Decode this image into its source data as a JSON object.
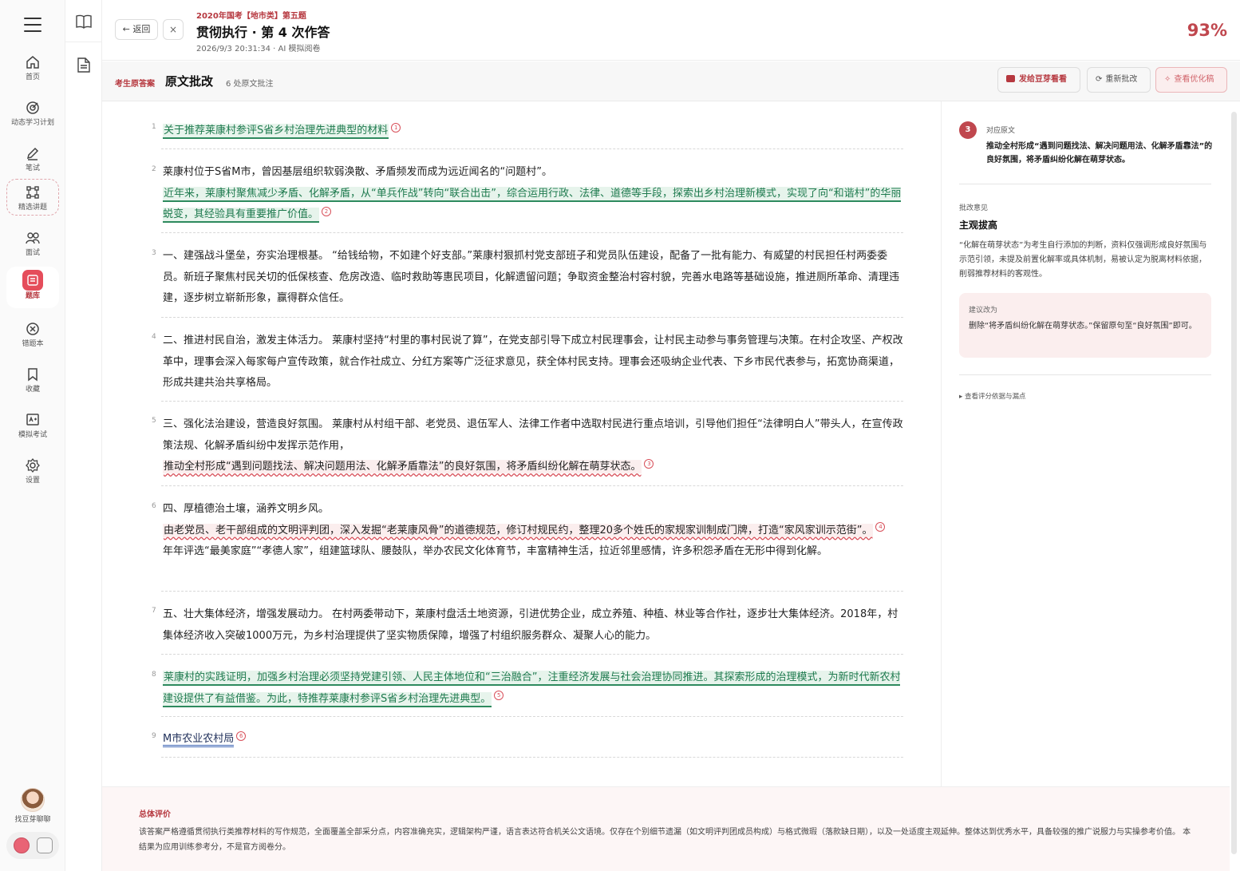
{
  "nav": {
    "items": [
      {
        "label": "首页",
        "icon": "home-icon"
      },
      {
        "label": "动态学习计划",
        "icon": "target-icon"
      },
      {
        "label": "笔试",
        "icon": "pen-icon"
      },
      {
        "label": "精选讲题",
        "icon": "nodes-icon"
      },
      {
        "label": "面试",
        "icon": "people-icon"
      },
      {
        "label": "题库",
        "icon": "list-icon"
      },
      {
        "label": "错题本",
        "icon": "x-circle-icon"
      },
      {
        "label": "收藏",
        "icon": "bookmark-icon"
      },
      {
        "label": "模拟考试",
        "icon": "exam-icon"
      },
      {
        "label": "设置",
        "icon": "gear-icon"
      }
    ],
    "avatar_label": "找豆芽聊聊"
  },
  "header": {
    "back_label": "← 返回",
    "close_label": "×",
    "subtitle": "2020年国考【地市类】第五题",
    "title": "贯彻执行 · 第 4 次作答",
    "meta": "2026/9/3 20:31:34 · AI 模拟阅卷",
    "score": "93%"
  },
  "toolbar": {
    "tag": "考生原答案",
    "title": "原文批改",
    "count": "6 处原文批注",
    "btn_send": "发给豆芽看看",
    "btn_regrade": "重新批改",
    "btn_optimized": "查看优化稿"
  },
  "doc": {
    "p1": {
      "n": "1",
      "a": "关于推荐莱康村参评S省乡村治理先进典型的材料",
      "m": "1"
    },
    "p2": {
      "n": "2",
      "a": "莱康村位于S省M市，曾因基层组织软弱涣散、矛盾频发而成为远近闻名的“问题村”。",
      "b": "近年来，莱康村聚焦减少矛盾、化解矛盾，从“单兵作战”转向“联合出击”，综合运用行政、法律、道德等手段，探索出乡村治理新模式，实现了向“和谐村”的华丽蜕变，其经验具有重要推广价值。",
      "m": "2"
    },
    "p3": {
      "n": "3",
      "a": "一、建强战斗堡垒，夯实治理根基。 “给钱给物，不如建个好支部。”莱康村狠抓村党支部班子和党员队伍建设，配备了一批有能力、有威望的村民担任村两委委员。新班子聚焦村民关切的低保核查、危房改造、临时救助等惠民项目，化解遗留问题；争取资金整治村容村貌，完善水电路等基础设施，推进厕所革命、清理违建，逐步树立崭新形象，赢得群众信任。"
    },
    "p4": {
      "n": "4",
      "a": "二、推进村民自治，激发主体活力。 莱康村坚持“村里的事村民说了算”，在党支部引导下成立村民理事会，让村民主动参与事务管理与决策。在村企攻坚、产权改革中，理事会深入每家每户宣传政策，就合作社成立、分红方案等广泛征求意见，获全体村民支持。理事会还吸纳企业代表、下乡市民代表参与，拓宽协商渠道，形成共建共治共享格局。"
    },
    "p5": {
      "n": "5",
      "a": "三、强化法治建设，营造良好氛围。 莱康村从村组干部、老党员、退伍军人、法律工作者中选取村民进行重点培训，引导他们担任“法律明白人”带头人，在宣传政策法规、化解矛盾纠纷中发挥示范作用，",
      "b": "推动全村形成“遇到问题找法、解决问题用法、化解矛盾靠法”的良好氛围，将矛盾纠纷化解在萌芽状态。",
      "m": "3"
    },
    "p6": {
      "n": "6",
      "a": "四、厚植德治土壤，涵养文明乡风。",
      "b": "由老党员、老干部组成的文明评判团，深入发掘“老莱康风骨”的道德规范，修订村规民约，整理20多个姓氏的家规家训制成门牌，打造“家风家训示范街”。",
      "m": "4",
      "c": "年年评选“最美家庭”“孝德人家”，组建篮球队、腰鼓队，举办农民文化体育节，丰富精神生活，拉近邻里感情，许多积怨矛盾在无形中得到化解。"
    },
    "p7": {
      "n": "7",
      "a": "五、壮大集体经济，增强发展动力。 在村两委带动下，莱康村盘活土地资源，引进优势企业，成立养殖、种植、林业等合作社，逐步壮大集体经济。2018年，村集体经济收入突破1000万元，为乡村治理提供了坚实物质保障，增强了村组织服务群众、凝聚人心的能力。"
    },
    "p8": {
      "n": "8",
      "a": "莱康村的实践证明，加强乡村治理必须坚持党建引领、人民主体地位和“三治融合”，注重经济发展与社会治理协同推进。其探索形成的治理模式，为新时代新农村建设提供了有益借鉴。为此，特推荐莱康村参评S省乡村治理先进典型。",
      "m": "5"
    },
    "p9": {
      "n": "9",
      "a": "M市农业农村局",
      "m": "6"
    }
  },
  "side": {
    "num": "3",
    "label_original": "对应原文",
    "quote": "推动全村形成“遇到问题找法、解决问题用法、化解矛盾靠法”的良好氛围，将矛盾纠纷化解在萌芽状态。",
    "label_comment": "批改意见",
    "heading": "主观拔高",
    "body": "“化解在萌芽状态”为考生自行添加的判断，资料仅强调形成良好氛围与示范引领，未提及前置化解率或具体机制，易被认定为脱离材料依据，削弱推荐材料的客观性。",
    "suggest_label": "建议改为",
    "suggest_body": "删除“将矛盾纠纷化解在萌芽状态。”保留原句至“良好氛围”即可。",
    "more": "▸ 查看评分依据与漏点"
  },
  "summary": {
    "title": "总体评价",
    "body": "该答案严格遵循贯彻执行类推荐材料的写作规范，全面覆盖全部采分点，内容准确充实，逻辑架构严谨，语言表达符合机关公文语境。仅存在个别细节遗漏（如文明评判团成员构成）与格式微瑕（落款缺日期），以及一处适度主观延伸。整体达到优秀水平，具备较强的推广说服力与实操参考价值。 本结果为应用训练参考分，不是官方阅卷分。"
  },
  "colors": {
    "accent": "#c0474e",
    "green": "#2e8a5e",
    "blue": "#3e66b5"
  }
}
